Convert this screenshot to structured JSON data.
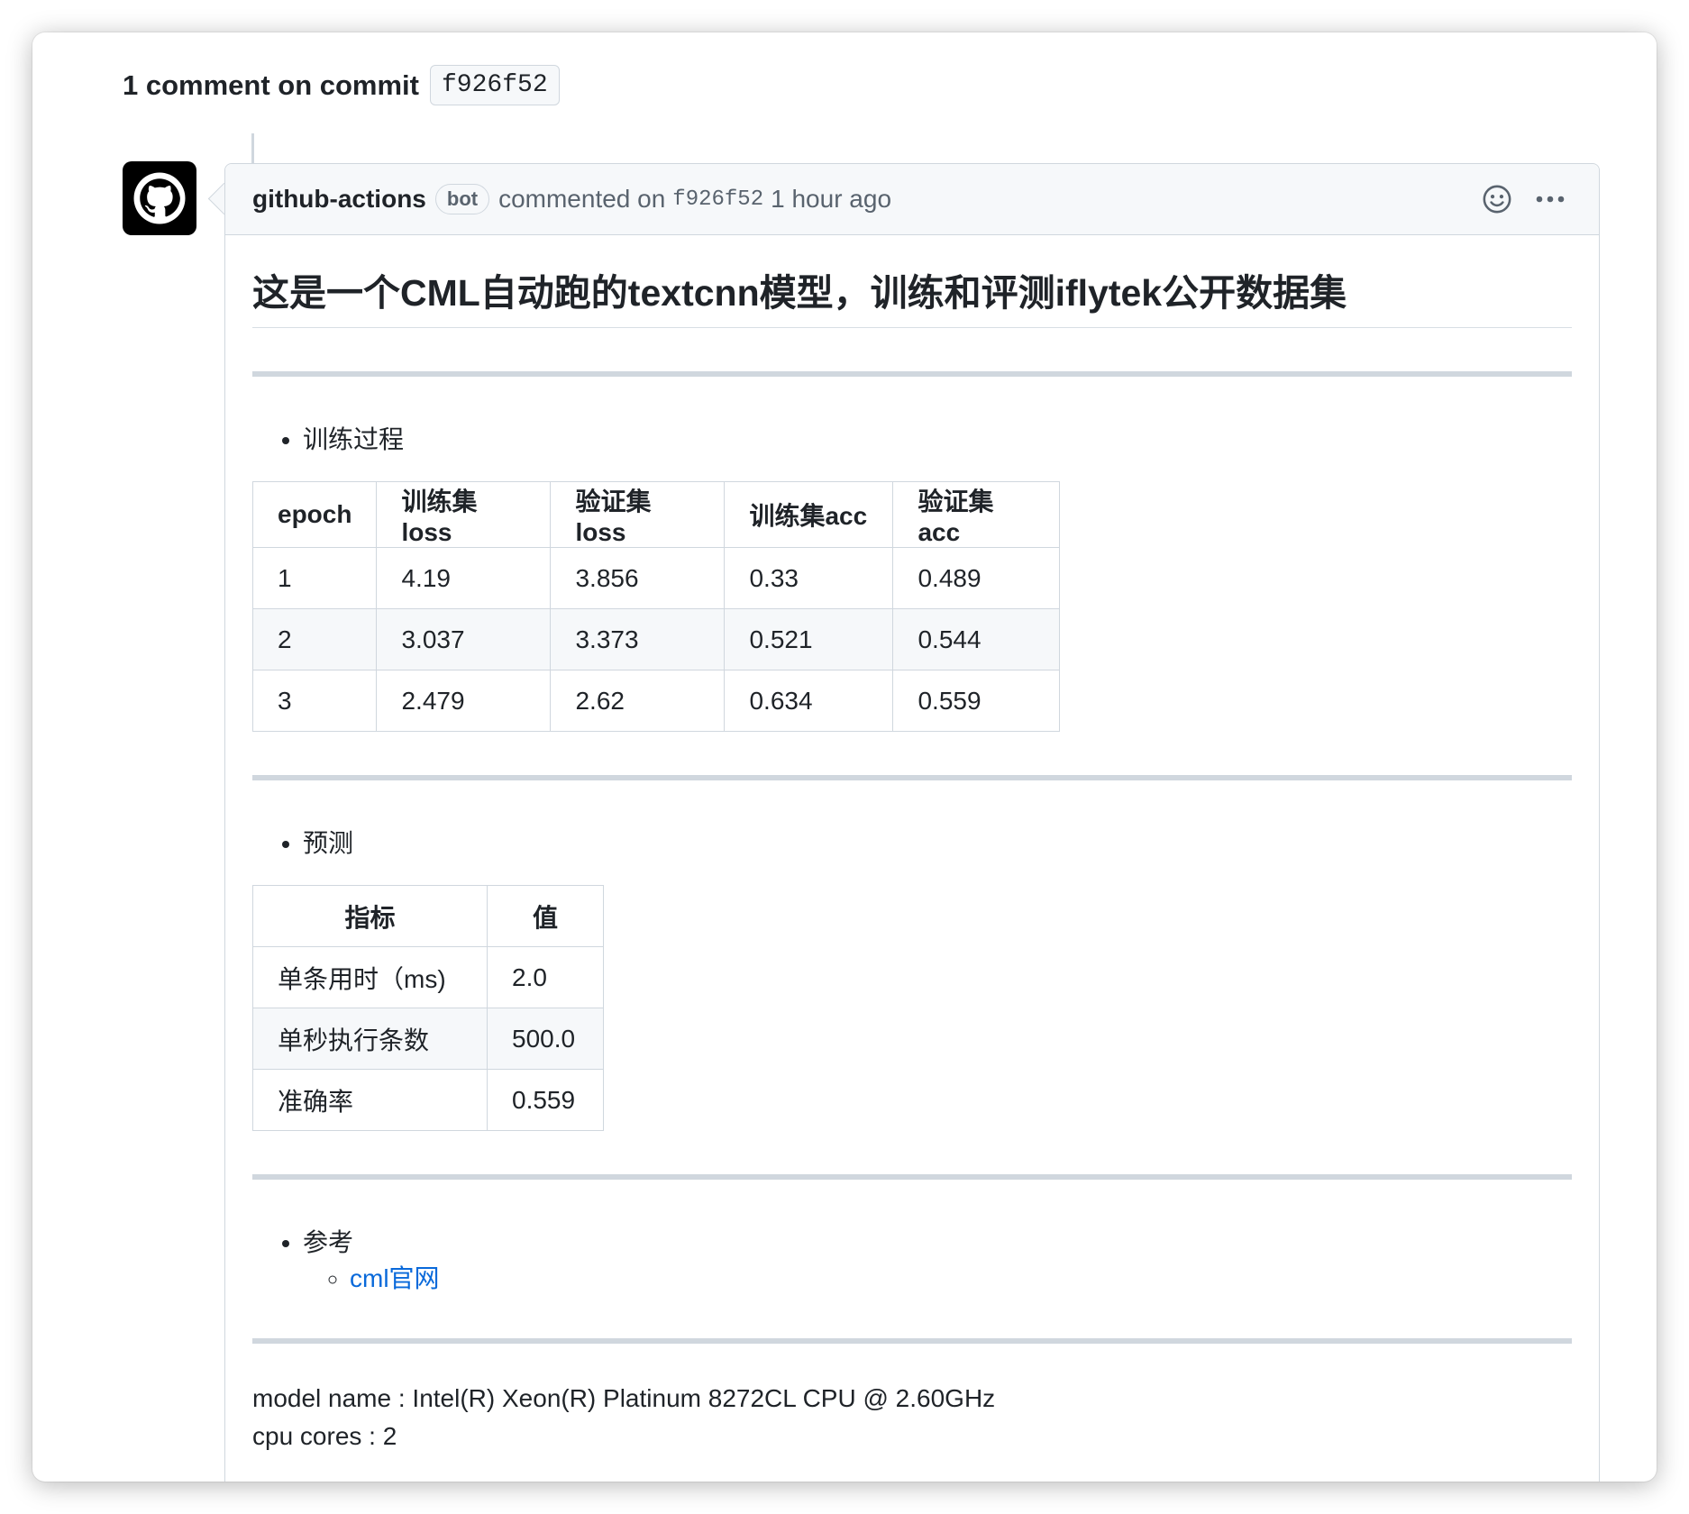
{
  "commit": {
    "heading": "1 comment on commit",
    "sha": "f926f52"
  },
  "comment": {
    "author": "github-actions",
    "bot_label": "bot",
    "commented_on": "commented on",
    "sha": "f926f52",
    "time": "1 hour ago",
    "title": "这是一个CML自动跑的textcnn模型，训练和评测iflytek公开数据集",
    "sections": {
      "training": "训练过程",
      "prediction": "预测",
      "references": "参考",
      "reference_link": "cml官网"
    },
    "training_table": {
      "headers": [
        "epoch",
        "训练集loss",
        "验证集loss",
        "训练集acc",
        "验证集acc"
      ],
      "rows": [
        [
          "1",
          "4.19",
          "3.856",
          "0.33",
          "0.489"
        ],
        [
          "2",
          "3.037",
          "3.373",
          "0.521",
          "0.544"
        ],
        [
          "3",
          "2.479",
          "2.62",
          "0.634",
          "0.559"
        ]
      ]
    },
    "prediction_table": {
      "headers": [
        "指标",
        "值"
      ],
      "rows": [
        [
          "单条用时（ms)",
          "2.0"
        ],
        [
          "单秒执行条数",
          "500.0"
        ],
        [
          "准确率",
          "0.559"
        ]
      ]
    },
    "system_info": {
      "model_name": "model name : Intel(R) Xeon(R) Platinum 8272CL CPU @ 2.60GHz",
      "cpu_cores": "cpu cores : 2"
    }
  },
  "icons": {
    "avatar": "github-octocat-icon",
    "emoji": "smiley-icon",
    "menu": "kebab-horizontal-icon"
  }
}
